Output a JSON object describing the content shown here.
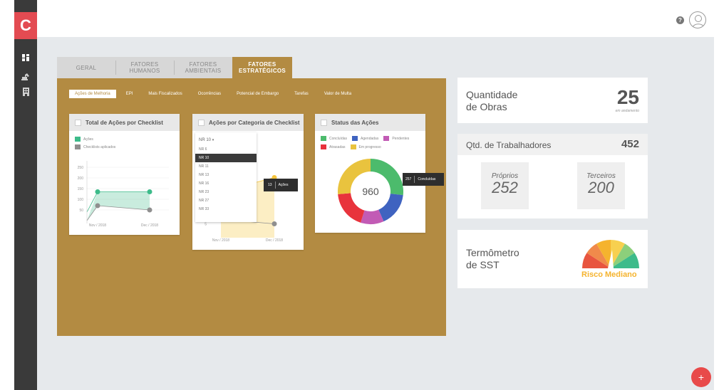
{
  "app": {
    "logo_letter": "C"
  },
  "rail": {
    "icons": [
      "dashboard-icon",
      "excavator-icon",
      "building-icon"
    ]
  },
  "topbar": {
    "help": "?"
  },
  "tabs": [
    {
      "line1": "GERAL",
      "line2": ""
    },
    {
      "line1": "FATORES",
      "line2": "HUMANOS"
    },
    {
      "line1": "FATORES",
      "line2": "AMBIENTAIS"
    },
    {
      "line1": "FATORES",
      "line2": "ESTRATÉGICOS"
    }
  ],
  "subtabs": [
    "Ações de Melhoria",
    "EPI",
    "Mais Fiscalizados",
    "Ocorrências",
    "Potencial de Embargo",
    "Tarefas",
    "Valor de Multa"
  ],
  "card1": {
    "title": "Total de Ações por Checklist",
    "legend": [
      "Ações",
      "Checklists aplicados"
    ],
    "colors": [
      "#3dbb8a",
      "#8f8f8f"
    ],
    "chart_data": {
      "type": "area",
      "categories": [
        "Nov / 2018",
        "Dec / 2018"
      ],
      "yticks": [
        50,
        100,
        150,
        200,
        250
      ],
      "ylim": [
        0,
        280
      ],
      "series": [
        {
          "name": "Ações",
          "values": [
            135,
            135
          ]
        },
        {
          "name": "Checklists aplicados",
          "values": [
            70,
            50
          ]
        }
      ]
    }
  },
  "card2": {
    "title": "Ações por Categoria de Checklist",
    "dropdown_selected": "NR 10",
    "dropdown_items": [
      "NR 6",
      "NR 10",
      "NR 11",
      "NR 13",
      "NR 16",
      "NR 23",
      "NR 27",
      "NR 33"
    ],
    "tooltip_value": "13",
    "tooltip_label": "Ações",
    "ytick_visible": "5",
    "chart_data": {
      "type": "area",
      "categories": [
        "Nov / 2018",
        "Dec / 2018"
      ],
      "series": [
        {
          "name": "Ações",
          "values": [
            10,
            13
          ]
        },
        {
          "name": "",
          "values": [
            4,
            3
          ]
        }
      ]
    }
  },
  "card3": {
    "title": "Status das Ações",
    "legend": [
      {
        "label": "Concluídas",
        "color": "#4cbb6c"
      },
      {
        "label": "Agendadas",
        "color": "#3f63c0"
      },
      {
        "label": "Pendentes",
        "color": "#c25bb5"
      },
      {
        "label": "Atrasadas",
        "color": "#e8333c"
      },
      {
        "label": "Em progresso",
        "color": "#e9c33e"
      }
    ],
    "total": "960",
    "tooltip_value": "257",
    "tooltip_label": "Concluídas",
    "chart_data": {
      "type": "pie",
      "categories": [
        "Concluídas",
        "Agendadas",
        "Pendentes",
        "Atrasadas",
        "Em progresso"
      ],
      "values": [
        257,
        160,
        110,
        180,
        253
      ]
    }
  },
  "obras": {
    "title1": "Quantidade",
    "title2": "de Obras",
    "value": "25",
    "sub": "em andamento"
  },
  "trabalhadores": {
    "title": "Qtd. de Trabalhadores",
    "value": "452",
    "proprios_label": "Próprios",
    "proprios_value": "252",
    "terceiros_label": "Terceiros",
    "terceiros_value": "200"
  },
  "termometro": {
    "title1": "Termômetro",
    "title2": "de SST",
    "gauge_label": "Risco Mediano",
    "gauge_color": "#f5b32e"
  },
  "fab": {
    "label": "+"
  }
}
